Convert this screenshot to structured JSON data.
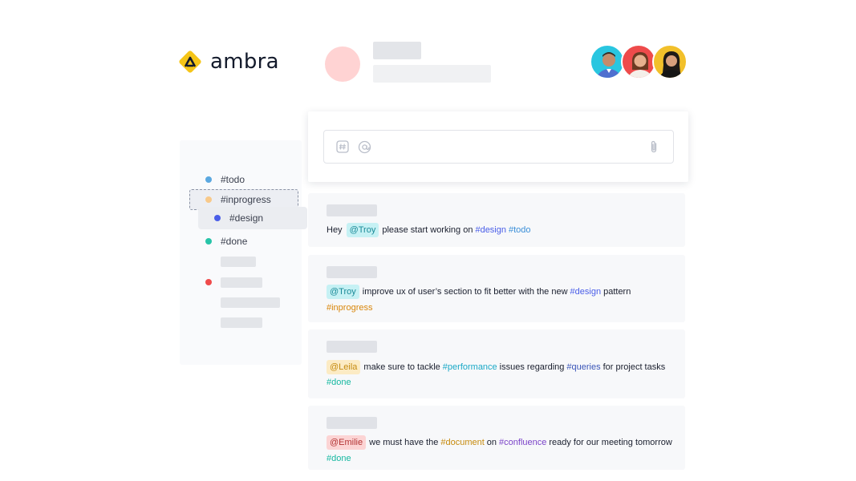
{
  "brand": {
    "name": "ambra",
    "logo_color": "#f5c518"
  },
  "sidebar": {
    "tags": [
      {
        "label": "#todo",
        "color": "#5ba8e0"
      },
      {
        "label": "#inprogress",
        "color": "#f8c98a"
      },
      {
        "label": "#design",
        "color": "#4a5ee8"
      },
      {
        "label": "#done",
        "color": "#27c4a8"
      }
    ],
    "extra_dot_color": "#ef4b4b"
  },
  "messages": [
    {
      "parts": [
        {
          "text": "Hey",
          "kind": "text"
        },
        {
          "text": "@Troy",
          "kind": "mention-troy"
        },
        {
          "text": "please start working on",
          "kind": "text"
        },
        {
          "text": "#design",
          "kind": "tag-design"
        },
        {
          "text": "#todo",
          "kind": "tag-todo"
        }
      ]
    },
    {
      "line1": [
        {
          "text": "@Troy",
          "kind": "mention-troy"
        },
        {
          "text": "improve ux of user’s section to fit better with the new",
          "kind": "text"
        },
        {
          "text": "#design",
          "kind": "tag-design"
        },
        {
          "text": "pattern",
          "kind": "text"
        }
      ],
      "line2": [
        {
          "text": "#inprogress",
          "kind": "tag-inprogress"
        }
      ]
    },
    {
      "line1": [
        {
          "text": "@Leila",
          "kind": "mention-leila"
        },
        {
          "text": "make sure to tackle",
          "kind": "text"
        },
        {
          "text": "#performance",
          "kind": "tag-performance"
        },
        {
          "text": "issues regarding",
          "kind": "text"
        },
        {
          "text": "#queries",
          "kind": "tag-queries"
        },
        {
          "text": "for project tasks",
          "kind": "text"
        }
      ],
      "line2": [
        {
          "text": "#done",
          "kind": "tag-done"
        }
      ]
    },
    {
      "line1": [
        {
          "text": "@Emilie",
          "kind": "mention-emilie"
        },
        {
          "text": "we must have the",
          "kind": "text"
        },
        {
          "text": "#document",
          "kind": "tag-document"
        },
        {
          "text": "on",
          "kind": "text"
        },
        {
          "text": "#confluence",
          "kind": "tag-confluence"
        },
        {
          "text": "ready for our meeting tomorrow",
          "kind": "text"
        }
      ],
      "line2": [
        {
          "text": "#done",
          "kind": "tag-done"
        }
      ]
    }
  ],
  "composer": {
    "icons": [
      "hash-icon",
      "at-icon",
      "paperclip-icon"
    ]
  },
  "team_avatar_colors": [
    "#29c6e0",
    "#ee4b4b",
    "#f2c02a"
  ]
}
